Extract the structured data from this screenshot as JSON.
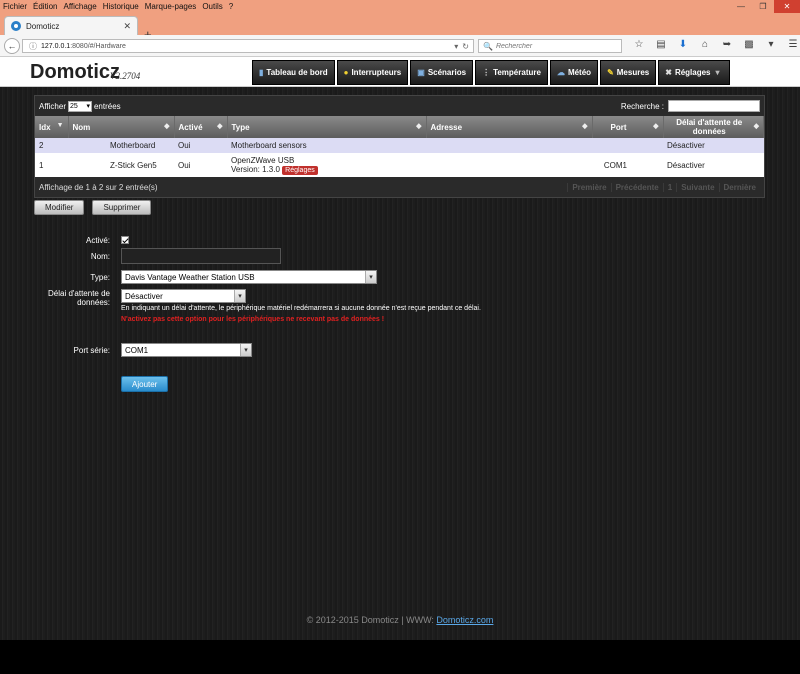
{
  "browser": {
    "menu": [
      "Fichier",
      "Édition",
      "Affichage",
      "Historique",
      "Marque-pages",
      "Outils",
      "?"
    ],
    "tab_title": "Domoticz",
    "url_host": "127.0.0.1",
    "url_rest": ":8080/#/Hardware",
    "search_placeholder": "Rechercher"
  },
  "app": {
    "logo": "Domoticz",
    "version": "V2.2704"
  },
  "nav": [
    {
      "label": "Tableau de bord",
      "icon": "dashboard-icon"
    },
    {
      "label": "Interrupteurs",
      "icon": "lightbulb-icon"
    },
    {
      "label": "Scénarios",
      "icon": "scenes-icon"
    },
    {
      "label": "Température",
      "icon": "thermometer-icon"
    },
    {
      "label": "Météo",
      "icon": "weather-icon"
    },
    {
      "label": "Mesures",
      "icon": "utility-icon"
    },
    {
      "label": "Réglages",
      "icon": "tools-icon",
      "dropdown": true
    }
  ],
  "table": {
    "show_prefix": "Afficher",
    "page_length": "25",
    "show_suffix": "entrées",
    "search_label": "Recherche :",
    "columns": [
      "Idx",
      "Nom",
      "Activé",
      "Type",
      "Adresse",
      "Port",
      "Délai d'attente de données"
    ],
    "rows": [
      {
        "idx": "2",
        "nom": "Motherboard",
        "active": "Oui",
        "type": "Motherboard sensors",
        "adresse": "",
        "port": "",
        "delai": "Désactiver"
      },
      {
        "idx": "1",
        "nom": "Z-Stick Gen5",
        "active": "Oui",
        "type": "OpenZWave USB",
        "type_version": "Version: 1.3.0",
        "type_badge": "Réglages",
        "adresse": "",
        "port": "COM1",
        "delai": "Désactiver"
      }
    ],
    "info": "Affichage de 1 à 2 sur 2 entrée(s)",
    "pager": [
      "Première",
      "Précédente",
      "1",
      "Suivante",
      "Dernière"
    ]
  },
  "buttons": {
    "modify": "Modifier",
    "delete": "Supprimer",
    "add": "Ajouter"
  },
  "form": {
    "active_label": "Activé:",
    "name_label": "Nom:",
    "type_label": "Type:",
    "type_value": "Davis Vantage Weather Station USB",
    "timeout_label": "Délai d'attente de données:",
    "timeout_value": "Désactiver",
    "timeout_hint": "En indiquant un délai d'attente, le périphérique matériel redémarrera si aucune donnée n'est reçue pendant ce délai.",
    "timeout_warning": "N'activez pas cette option pour les périphériques ne recevant pas de données !",
    "port_label": "Port série:",
    "port_value": "COM1"
  },
  "footer": {
    "text": "© 2012-2015 Domoticz | WWW:",
    "link": "Domoticz.com"
  }
}
